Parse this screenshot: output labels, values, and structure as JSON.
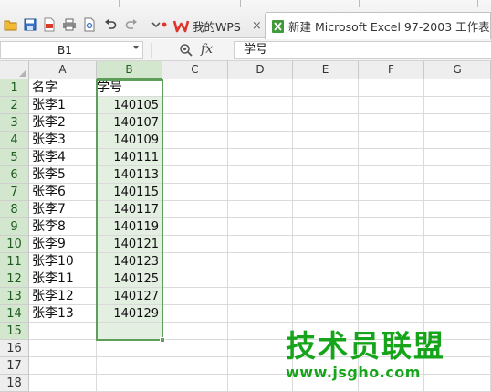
{
  "tabs": {
    "home_label": "我的WPS",
    "home_close": "×",
    "document_title": "新建 Microsoft Excel 97-2003 工作表.xls"
  },
  "formula_bar": {
    "cell_reference": "B1",
    "fx_label": "fx",
    "content": "学号"
  },
  "sheet": {
    "columns": [
      "A",
      "B",
      "C",
      "D",
      "E",
      "F",
      "G"
    ],
    "rows": [
      "1",
      "2",
      "3",
      "4",
      "5",
      "6",
      "7",
      "8",
      "9",
      "10",
      "11",
      "12",
      "13",
      "14",
      "15",
      "16",
      "17",
      "18"
    ],
    "col_a": [
      "名字",
      "张李1",
      "张李2",
      "张李3",
      "张李4",
      "张李5",
      "张李6",
      "张李7",
      "张李8",
      "张李9",
      "张李10",
      "张李11",
      "张李12",
      "张李13"
    ],
    "col_b": [
      "学号",
      "140105",
      "140107",
      "140109",
      "140111",
      "140113",
      "140115",
      "140117",
      "140119",
      "140121",
      "140123",
      "140125",
      "140127",
      "140129"
    ],
    "selected_column": "B",
    "selection_color": "#5f9d5a"
  },
  "watermark": {
    "title": "技术员联盟",
    "url": "www.jsgho.com",
    "color": "#16a51a"
  },
  "icons": {
    "wps_logo": "wps-w-logo-icon",
    "doc_icon": "spreadsheet-doc-icon"
  }
}
